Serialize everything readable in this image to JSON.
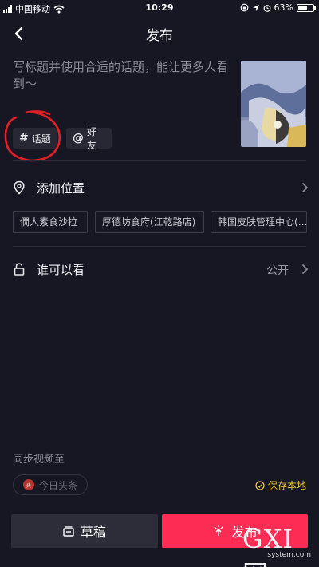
{
  "status_bar": {
    "carrier": "中国移动",
    "time": "10:29",
    "battery_percent": 63,
    "battery_text": "63%"
  },
  "nav": {
    "title": "发布",
    "back_icon": "chevron-left-icon"
  },
  "post": {
    "caption_placeholder": "写标题并使用合适的话题，能让更多人看到～",
    "topic_chip": {
      "symbol": "#",
      "label": "话题"
    },
    "friend_chip": {
      "symbol": "@",
      "label": "好友"
    }
  },
  "location": {
    "label": "添加位置",
    "icon": "location-pin-icon",
    "suggestions": [
      "僩人素食沙拉",
      "厚德坊食府(江乾路店)",
      "韩国皮肤管理中心(…"
    ]
  },
  "visibility": {
    "label": "谁可以看",
    "value": "公开",
    "icon": "lock-icon"
  },
  "sync": {
    "label": "同步视频至",
    "toutiao": "今日头条",
    "save_local": "保存本地"
  },
  "footer": {
    "draft_label": "草稿",
    "publish_label": "发布"
  },
  "watermark": {
    "main": "GXI网",
    "sub": "system.com"
  },
  "colors": {
    "background": "#161722",
    "accent": "#fd2c55",
    "save_local": "#e9c53a",
    "annotation": "#e01f26"
  }
}
